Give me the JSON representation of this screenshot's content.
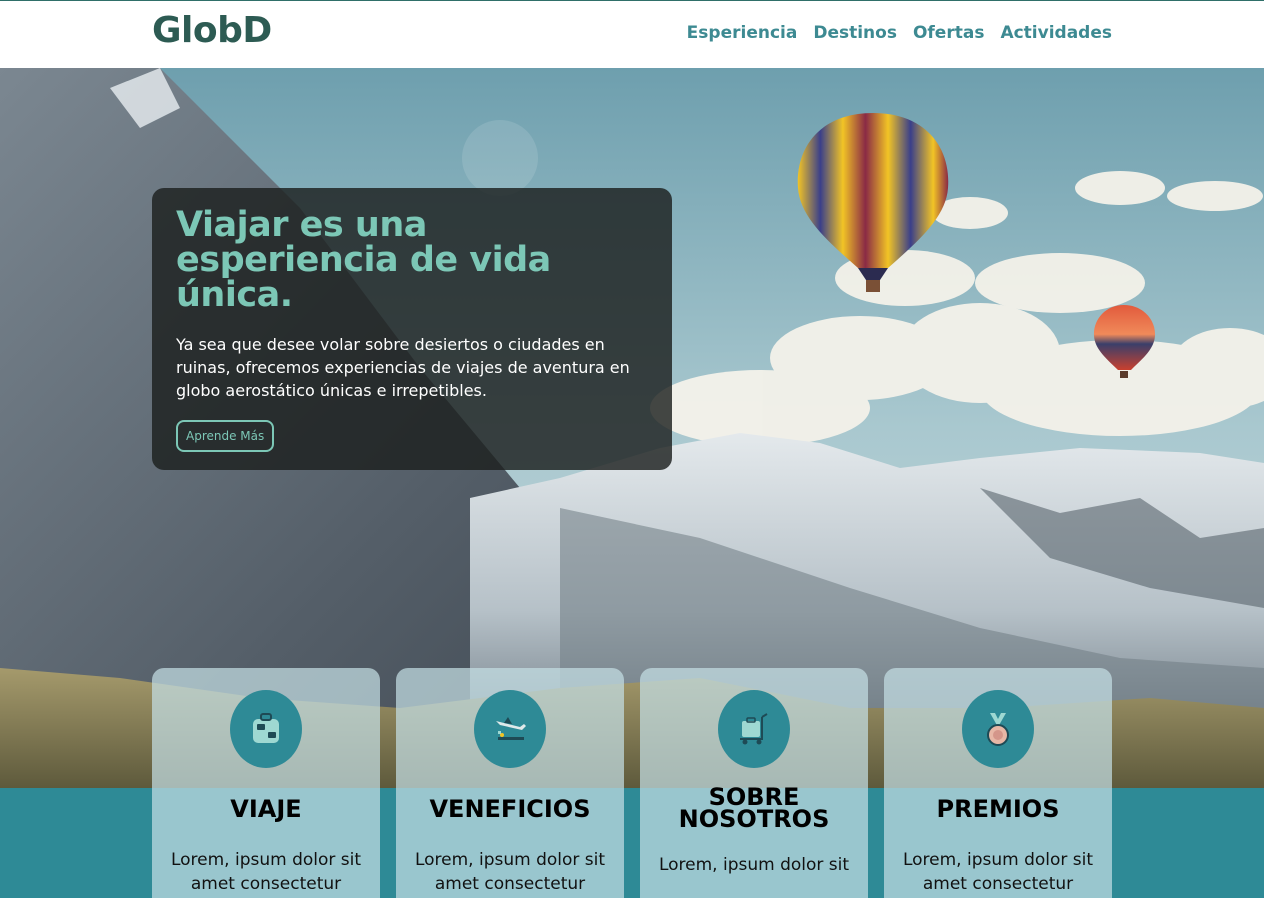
{
  "brand": {
    "logo": "GlobD"
  },
  "nav": {
    "items": [
      "Esperiencia",
      "Destinos",
      "Ofertas",
      "Actividades"
    ]
  },
  "hero": {
    "title": "Viajar es una esperiencia de vida única.",
    "text": "Ya sea que desee volar sobre desiertos o ciudades en ruinas, ofrecemos experiencias de viajes de aventura en globo aerostático únicas e irrepetibles.",
    "button_label": "Aprende Más"
  },
  "cards": [
    {
      "title": "VIAJE",
      "text": "Lorem, ipsum dolor sit amet consectetur",
      "icon": "luggage-icon"
    },
    {
      "title": "VENEFICIOS",
      "text": "Lorem, ipsum dolor sit amet consectetur",
      "icon": "airplane-landing-icon"
    },
    {
      "title": "SOBRE NOSOTROS",
      "text": "Lorem, ipsum dolor sit",
      "icon": "baggage-cart-icon"
    },
    {
      "title": "PREMIOS",
      "text": "Lorem, ipsum dolor sit amet consectetur",
      "icon": "medal-icon"
    }
  ],
  "colors": {
    "brand": "#2d5b53",
    "accent": "#7cc7b6",
    "teal": "#2e8a96",
    "nav": "#3d8a92"
  }
}
